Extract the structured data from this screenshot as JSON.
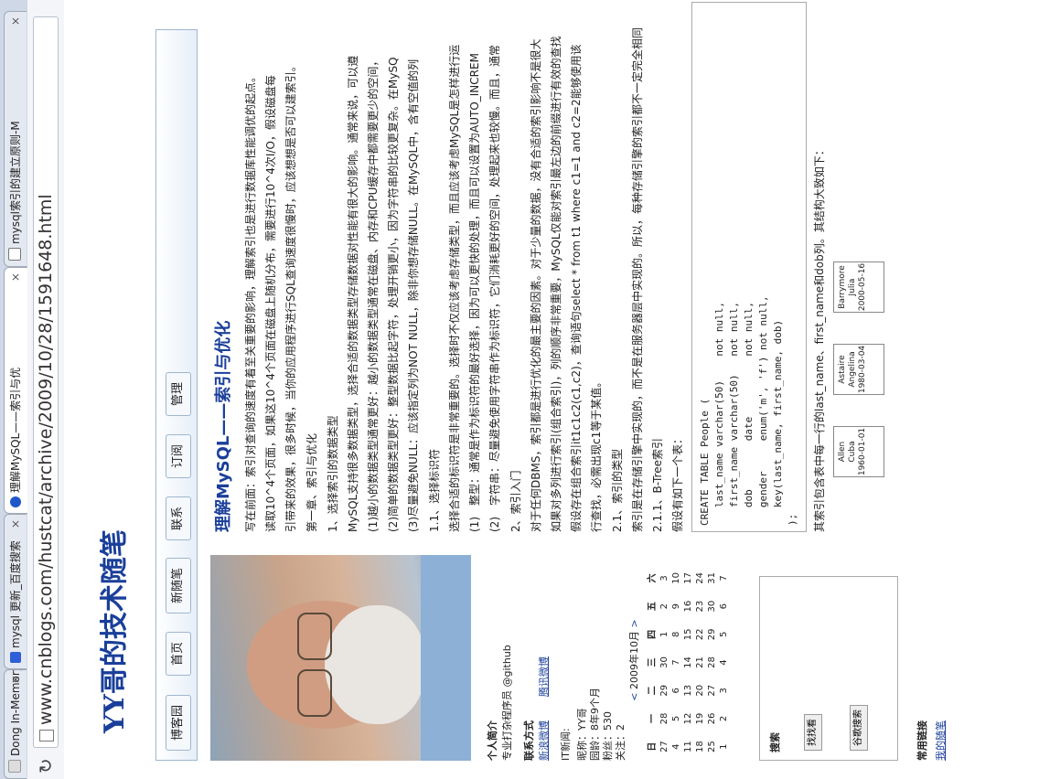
{
  "tabs": [
    {
      "label": "Dong In-Memory D",
      "icon": "document-icon",
      "active": false
    },
    {
      "label": "mysql 更新_百度搜索",
      "icon": "baidu-icon",
      "active": false
    },
    {
      "label": "理解MySQL——索引与优",
      "icon": "page-icon",
      "active": true
    },
    {
      "label": "mysql索引的建立原则-M",
      "icon": "document-icon",
      "active": false
    }
  ],
  "address": {
    "url": "www.cnblogs.com/hustcat/archive/2009/10/28/1591648.html"
  },
  "site": {
    "title": "YY哥的技术随笔"
  },
  "nav": [
    "博客园",
    "首页",
    "新随笔",
    "联系",
    "订阅",
    "管理"
  ],
  "sidebar": {
    "profile_head": "个人简介",
    "profile_text": "专业打杂程序员 @github",
    "contact_head": "联系方式",
    "contact_links": [
      "新浪微博",
      "腾讯微博"
    ],
    "it_head": "IT新闻:",
    "nickname": "昵称：YY哥",
    "age": "园龄：8年9个月",
    "fans": "粉丝：530",
    "follow": "关注：2"
  },
  "calendar": {
    "title": "2009年10月",
    "prev": "<",
    "next": ">",
    "weekdays": [
      "日",
      "一",
      "二",
      "三",
      "四",
      "五",
      "六"
    ],
    "weeks": [
      [
        "27",
        "28",
        "29",
        "30",
        "1",
        "2",
        "3"
      ],
      [
        "4",
        "5",
        "6",
        "7",
        "8",
        "9",
        "10"
      ],
      [
        "11",
        "12",
        "13",
        "14",
        "15",
        "16",
        "17"
      ],
      [
        "18",
        "19",
        "20",
        "21",
        "22",
        "23",
        "24"
      ],
      [
        "25",
        "26",
        "27",
        "28",
        "29",
        "30",
        "31"
      ],
      [
        "1",
        "2",
        "3",
        "4",
        "5",
        "6",
        "7"
      ]
    ]
  },
  "search": {
    "label": "搜索",
    "find_button": "找找看",
    "google_button": "谷歌搜索",
    "links_head": "常用链接",
    "my_posts": "我的随笔"
  },
  "article": {
    "title": "理解MySQL——索引与优化",
    "paragraphs": [
      "写在前面：索引对查询的速度有着至关重要的影响，理解索引也是进行数据库性能调优的起点。",
      "读取10^4个页面，如果这10^4个页面在磁盘上随机分布，需要进行10^4次I/O，假设磁盘每",
      "引带来的效果，很多时候，当你的应用程序进行SQL查询速度很慢时，应该想想是否可以建索引。",
      "第一章、索引与优化",
      "1、选择索引的数据类型",
      "MySQL支持很多数据类型，选择合适的数据类型存储数据对性能有很大的影响。通常来说，可以遵",
      "(1)越小的数据类型通常更好：越小的数据类型通常在磁盘、内存和CPU缓存中都需要更少的空间，",
      "(2)简单的数据类型更好：整型数据比起字符，处理开销更小，因为字符串的比较更复杂。在MySQ",
      "(3)尽量避免NULL：应该指定列为NOT NULL，除非你想存储NULL。在MySQL中，含有空值的列",
      "1.1、选择标识符",
      "选择合适的标识符是非常重要的。选择时不仅应该考虑存储类型，而且应该考虑MySQL是怎样进行运",
      "(1)　整型：通常是作为标识符的最好选择，因为可以更快的处理，而且可以设置为AUTO_INCREM",
      "(2)　字符串：尽量避免使用字符串作为标识符，它们消耗更好的空间，处理起来也较慢。而且，通常",
      "2、索引入门",
      "对于任何DBMS，索引都是进行优化的最主要的因素。对于少量的数据，没有合适的索引影响不是很大",
      "如果对多列进行索引(组合索引)，列的顺序非常重要，MySQL仅能对索引最左边的前缀进行有效的查找",
      "假设存在组合索引it1c1c2(c1,c2)，查询语句select * from t1 where c1=1 and c2=2能够使用该",
      "行查找，必需出现c1等于某值。",
      "2.1、索引的类型",
      "索引是在存储引擎中实现的，而不是在服务器层中实现的。所以，每种存储引擎的索引都不一定完全相同",
      "2.1.1、B-Tree索引",
      "假设有如下一个表："
    ],
    "code": [
      "CREATE TABLE People (",
      "   last_name varchar(50)    not null,",
      "   first_name varchar(50)   not null,",
      "   dob        date          not null,",
      "   gender     enum('m', 'f') not null,",
      "   key(last_name, first_name, dob)",
      ");"
    ],
    "after_code": "其索引包含表中每一行的last_name、first_name和dob列。其结构大致如下：",
    "btree_nodes": [
      [
        "Allen",
        "Cuba",
        "1960-01-01"
      ],
      [
        "Astaire",
        "Angelina",
        "1980-03-04"
      ],
      [
        "Barrymore",
        "Julia",
        "2000-05-16"
      ]
    ]
  }
}
